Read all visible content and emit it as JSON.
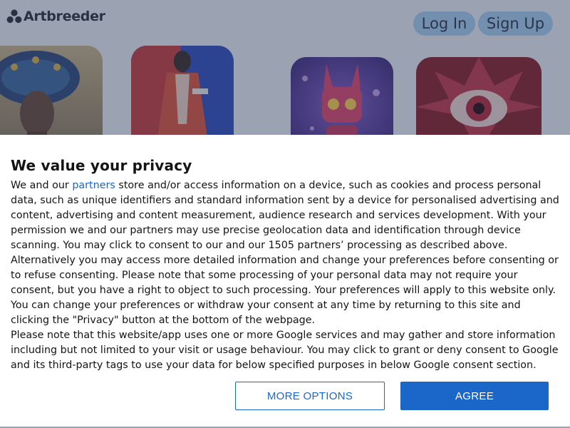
{
  "site": {
    "logo_text": "Artbreeder",
    "login_label": "Log In",
    "signup_label": "Sign Up",
    "colors": {
      "background": "#eef1f7",
      "auth_button": "#a9d0f5"
    },
    "gallery": [
      {
        "icon": "peacock-woman-portrait-image"
      },
      {
        "icon": "fashion-figure-red-coat-image"
      },
      {
        "icon": "pink-robot-bunny-image"
      },
      {
        "icon": "red-eye-flower-image"
      }
    ]
  },
  "consent": {
    "title": "We value your privacy",
    "p1_before_link": "We and our ",
    "partners_link": "partners",
    "p1_after_link": " store and/or access information on a device, such as cookies and process personal data, such as unique identifiers and standard information sent by a device for personalised advertising and content, advertising and content measurement, audience research and services development. With your permission we and our partners may use precise geolocation data and identification through device scanning. You may click to consent to our and our 1505 partners’ processing as described above. Alternatively you may access more detailed information and change your preferences before consenting or to refuse consenting. Please note that some processing of your personal data may not require your consent, but you have a right to object to such processing. Your preferences will apply to this website only. You can change your preferences or withdraw your consent at any time by returning to this site and clicking the \"Privacy\" button at the bottom of the webpage.",
    "p2": "Please note that this website/app uses one or more Google services and may gather and store information including but not limited to your visit or usage behaviour. You may click to grant or deny consent to Google and its third-party tags to use your data for below specified purposes in below Google consent section.",
    "more_options_label": "MORE OPTIONS",
    "agree_label": "AGREE",
    "colors": {
      "accent": "#1a67c9",
      "text": "#141414"
    }
  }
}
